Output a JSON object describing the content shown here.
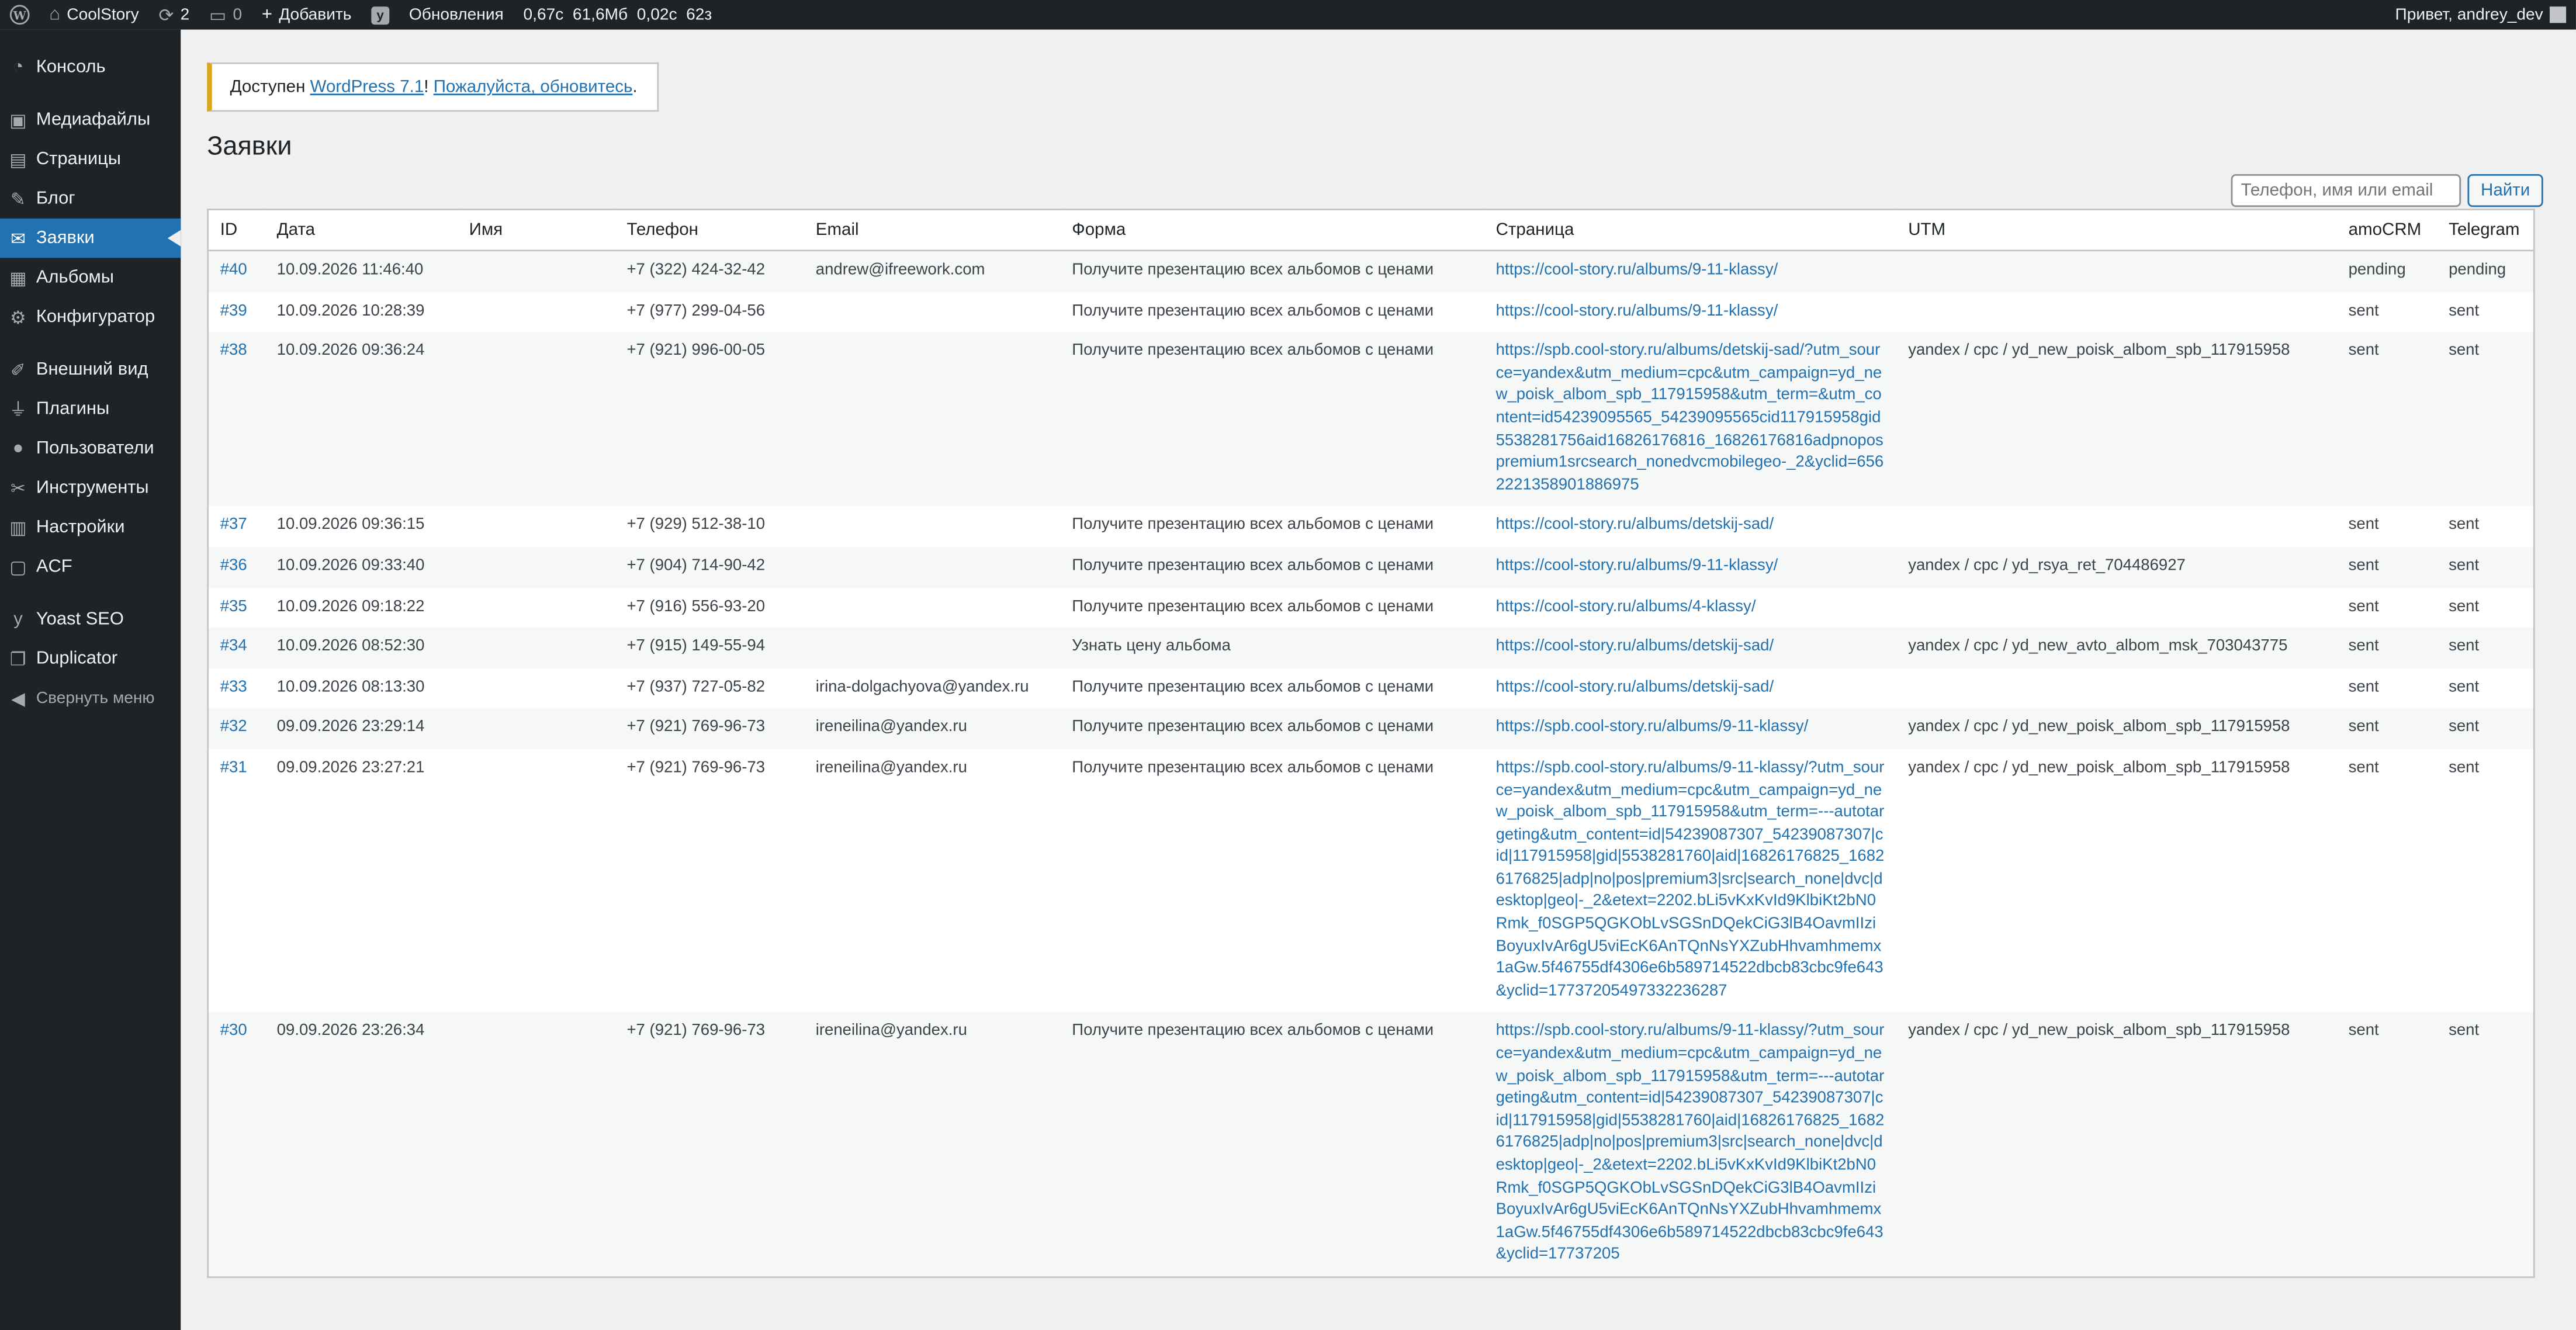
{
  "adminbar": {
    "site_name": "CoolStory",
    "updates_count": "2",
    "comments_count": "0",
    "add_label": "Добавить",
    "updates_label": "Обновления",
    "perf": "0,67с  61,6Мб  0,02с  62з",
    "greeting": "Привет, andrey_dev"
  },
  "sidebar": {
    "items": [
      {
        "label": "Консоль",
        "icon": "dashboard-icon"
      },
      {
        "label": "Медиафайлы",
        "icon": "media-icon"
      },
      {
        "label": "Страницы",
        "icon": "pages-icon"
      },
      {
        "label": "Блог",
        "icon": "pin-icon"
      },
      {
        "label": "Заявки",
        "icon": "email-icon"
      },
      {
        "label": "Альбомы",
        "icon": "album-icon"
      },
      {
        "label": "Конфигуратор",
        "icon": "gear-icon"
      },
      {
        "label": "Внешний вид",
        "icon": "brush-icon"
      },
      {
        "label": "Плагины",
        "icon": "plugin-icon"
      },
      {
        "label": "Пользователи",
        "icon": "user-icon"
      },
      {
        "label": "Инструменты",
        "icon": "wrench-icon"
      },
      {
        "label": "Настройки",
        "icon": "settings-icon"
      },
      {
        "label": "ACF",
        "icon": "acf-icon"
      },
      {
        "label": "Yoast SEO",
        "icon": "yoast-icon"
      },
      {
        "label": "Duplicator",
        "icon": "duplicator-icon"
      }
    ],
    "collapse_label": "Свернуть меню"
  },
  "notice": {
    "prefix": "Доступен ",
    "link1": "WordPress 7.1",
    "middle": "! ",
    "link2": "Пожалуйста, обновитесь",
    "suffix": "."
  },
  "page": {
    "title": "Заявки"
  },
  "search": {
    "placeholder": "Телефон, имя или email",
    "button": "Найти"
  },
  "table": {
    "columns": [
      "ID",
      "Дата",
      "Имя",
      "Телефон",
      "Email",
      "Форма",
      "Страница",
      "UTM",
      "amoCRM",
      "Telegram"
    ],
    "rows": [
      {
        "id": "#40",
        "date": "10.09.2026 11:46:40",
        "name": "",
        "phone": "+7 (322) 424-32-42",
        "email": "andrew@ifreework.com",
        "form": "Получите презентацию всех альбомов с ценами",
        "page": "https://cool-story.ru/albums/9-11-klassy/",
        "utm": "",
        "amo": "pending",
        "tg": "pending"
      },
      {
        "id": "#39",
        "date": "10.09.2026 10:28:39",
        "name": "",
        "phone": "+7 (977) 299-04-56",
        "email": "",
        "form": "Получите презентацию всех альбомов с ценами",
        "page": "https://cool-story.ru/albums/9-11-klassy/",
        "utm": "",
        "amo": "sent",
        "tg": "sent"
      },
      {
        "id": "#38",
        "date": "10.09.2026 09:36:24",
        "name": "",
        "phone": "+7 (921) 996-00-05",
        "email": "",
        "form": "Получите презентацию всех альбомов с ценами",
        "page": "https://spb.cool-story.ru/albums/detskij-sad/?utm_source=yandex&utm_medium=cpc&utm_campaign=yd_new_poisk_albom_spb_117915958&utm_term=&utm_content=id54239095565_54239095565cid117915958gid5538281756aid16826176816_16826176816adpnopospremium1srcsearch_nonedvcmobilegeo-_2&yclid=6562221358901886975",
        "utm": "yandex / cpc / yd_new_poisk_albom_spb_117915958",
        "amo": "sent",
        "tg": "sent"
      },
      {
        "id": "#37",
        "date": "10.09.2026 09:36:15",
        "name": "",
        "phone": "+7 (929) 512-38-10",
        "email": "",
        "form": "Получите презентацию всех альбомов с ценами",
        "page": "https://cool-story.ru/albums/detskij-sad/",
        "utm": "",
        "amo": "sent",
        "tg": "sent"
      },
      {
        "id": "#36",
        "date": "10.09.2026 09:33:40",
        "name": "",
        "phone": "+7 (904) 714-90-42",
        "email": "",
        "form": "Получите презентацию всех альбомов с ценами",
        "page": "https://cool-story.ru/albums/9-11-klassy/",
        "utm": "yandex / cpc / yd_rsya_ret_704486927",
        "amo": "sent",
        "tg": "sent"
      },
      {
        "id": "#35",
        "date": "10.09.2026 09:18:22",
        "name": "",
        "phone": "+7 (916) 556-93-20",
        "email": "",
        "form": "Получите презентацию всех альбомов с ценами",
        "page": "https://cool-story.ru/albums/4-klassy/",
        "utm": "",
        "amo": "sent",
        "tg": "sent"
      },
      {
        "id": "#34",
        "date": "10.09.2026 08:52:30",
        "name": "",
        "phone": "+7 (915) 149-55-94",
        "email": "",
        "form": "Узнать цену альбома",
        "page": "https://cool-story.ru/albums/detskij-sad/",
        "utm": "yandex / cpc / yd_new_avto_albom_msk_703043775",
        "amo": "sent",
        "tg": "sent"
      },
      {
        "id": "#33",
        "date": "10.09.2026 08:13:30",
        "name": "",
        "phone": "+7 (937) 727-05-82",
        "email": "irina-dolgachyova@yandex.ru",
        "form": "Получите презентацию всех альбомов с ценами",
        "page": "https://cool-story.ru/albums/detskij-sad/",
        "utm": "",
        "amo": "sent",
        "tg": "sent"
      },
      {
        "id": "#32",
        "date": "09.09.2026 23:29:14",
        "name": "",
        "phone": "+7 (921) 769-96-73",
        "email": "ireneilina@yandex.ru",
        "form": "Получите презентацию всех альбомов с ценами",
        "page": "https://spb.cool-story.ru/albums/9-11-klassy/",
        "utm": "yandex / cpc / yd_new_poisk_albom_spb_117915958",
        "amo": "sent",
        "tg": "sent"
      },
      {
        "id": "#31",
        "date": "09.09.2026 23:27:21",
        "name": "",
        "phone": "+7 (921) 769-96-73",
        "email": "ireneilina@yandex.ru",
        "form": "Получите презентацию всех альбомов с ценами",
        "page": "https://spb.cool-story.ru/albums/9-11-klassy/?utm_source=yandex&utm_medium=cpc&utm_campaign=yd_new_poisk_albom_spb_117915958&utm_term=---autotargeting&utm_content=id|54239087307_54239087307|cid|117915958|gid|5538281760|aid|16826176825_16826176825|adp|no|pos|premium3|src|search_none|dvc|desktop|geo|-_2&etext=2202.bLi5vKxKvId9KlbiKt2bN0Rmk_f0SGP5QGKObLvSGSnDQekCiG3lB4OavmIIziBoyuxIvAr6gU5viEcK6AnTQnNsYXZubHhvamhmemx1aGw.5f46755df4306e6b589714522dbcb83cbc9fe643&yclid=17737205497332236287",
        "utm": "yandex / cpc / yd_new_poisk_albom_spb_117915958",
        "amo": "sent",
        "tg": "sent"
      },
      {
        "id": "#30",
        "date": "09.09.2026 23:26:34",
        "name": "",
        "phone": "+7 (921) 769-96-73",
        "email": "ireneilina@yandex.ru",
        "form": "Получите презентацию всех альбомов с ценами",
        "page": "https://spb.cool-story.ru/albums/9-11-klassy/?utm_source=yandex&utm_medium=cpc&utm_campaign=yd_new_poisk_albom_spb_117915958&utm_term=---autotargeting&utm_content=id|54239087307_54239087307|cid|117915958|gid|5538281760|aid|16826176825_16826176825|adp|no|pos|premium3|src|search_none|dvc|desktop|geo|-_2&etext=2202.bLi5vKxKvId9KlbiKt2bN0Rmk_f0SGP5QGKObLvSGSnDQekCiG3lB4OavmIIziBoyuxIvAr6gU5viEcK6AnTQnNsYXZubHhvamhmemx1aGw.5f46755df4306e6b589714522dbcb83cbc9fe643&yclid=17737205",
        "utm": "yandex / cpc / yd_new_poisk_albom_spb_117915958",
        "amo": "sent",
        "tg": "sent"
      }
    ]
  }
}
